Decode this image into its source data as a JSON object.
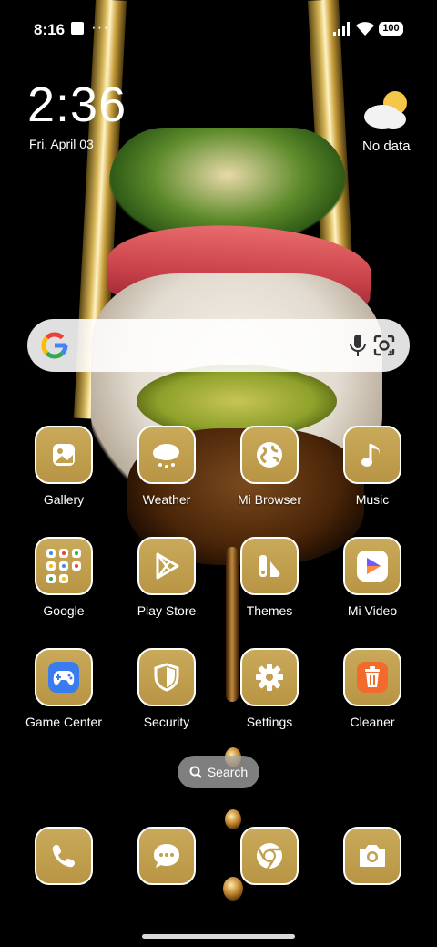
{
  "status_bar": {
    "time": "8:16",
    "more": "···",
    "battery": "100"
  },
  "clock_widget": {
    "time": "2:36",
    "date": "Fri, April 03"
  },
  "weather_widget": {
    "status": "No data",
    "icon": "partly-cloudy-icon"
  },
  "search_bar": {
    "logo": "google-g-icon",
    "mic_icon": "microphone-icon",
    "lens_icon": "google-lens-icon"
  },
  "apps": [
    {
      "label": "Gallery",
      "icon": "gallery-icon"
    },
    {
      "label": "Weather",
      "icon": "weather-icon"
    },
    {
      "label": "Mi Browser",
      "icon": "globe-icon"
    },
    {
      "label": "Music",
      "icon": "music-note-icon"
    },
    {
      "label": "Google",
      "icon": "google-folder-icon"
    },
    {
      "label": "Play Store",
      "icon": "play-store-icon"
    },
    {
      "label": "Themes",
      "icon": "themes-icon"
    },
    {
      "label": "Mi Video",
      "icon": "mi-video-icon"
    },
    {
      "label": "Game Center",
      "icon": "gamepad-icon"
    },
    {
      "label": "Security",
      "icon": "shield-icon"
    },
    {
      "label": "Settings",
      "icon": "gear-icon"
    },
    {
      "label": "Cleaner",
      "icon": "trash-icon"
    }
  ],
  "search_pill": {
    "label": "Search",
    "icon": "search-icon"
  },
  "dock": [
    {
      "icon": "phone-icon"
    },
    {
      "icon": "messages-icon"
    },
    {
      "icon": "chrome-icon"
    },
    {
      "icon": "camera-icon"
    }
  ],
  "colors": {
    "icon_gold": "#c1a04f",
    "icon_border": "#ffffff",
    "background": "#000000"
  }
}
